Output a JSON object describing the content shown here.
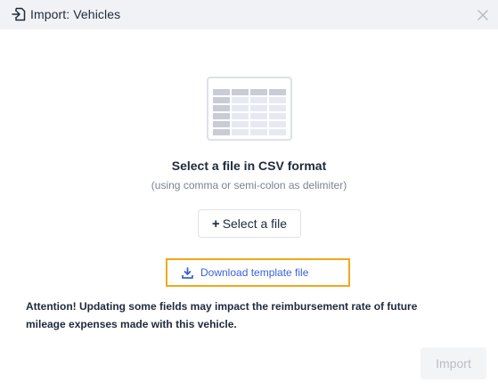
{
  "dialog": {
    "title": "Import: Vehicles",
    "header_icon": "import-file-icon",
    "close_icon": "close-icon"
  },
  "illustration": {
    "icon": "spreadsheet-table-illustration"
  },
  "upload": {
    "title": "Select a file in CSV format",
    "subtitle": "(using comma or semi-colon as delimiter)",
    "select_plus": "+",
    "select_label": "Select a file",
    "download_icon": "download-icon",
    "download_label": "Download template file"
  },
  "notice": {
    "text": "Attention! Updating some fields may impact the reimbursement rate of future mileage expenses made with this vehicle."
  },
  "footer": {
    "import_label": "Import",
    "import_enabled": false
  },
  "colors": {
    "header_bg": "#f1f2f5",
    "link": "#3a63d6",
    "highlight_border": "#f0a818",
    "text": "#1e2a3b",
    "muted_text": "#7b8390",
    "disabled_button_bg": "#f3f4f6",
    "disabled_button_text": "#b9bec6"
  }
}
